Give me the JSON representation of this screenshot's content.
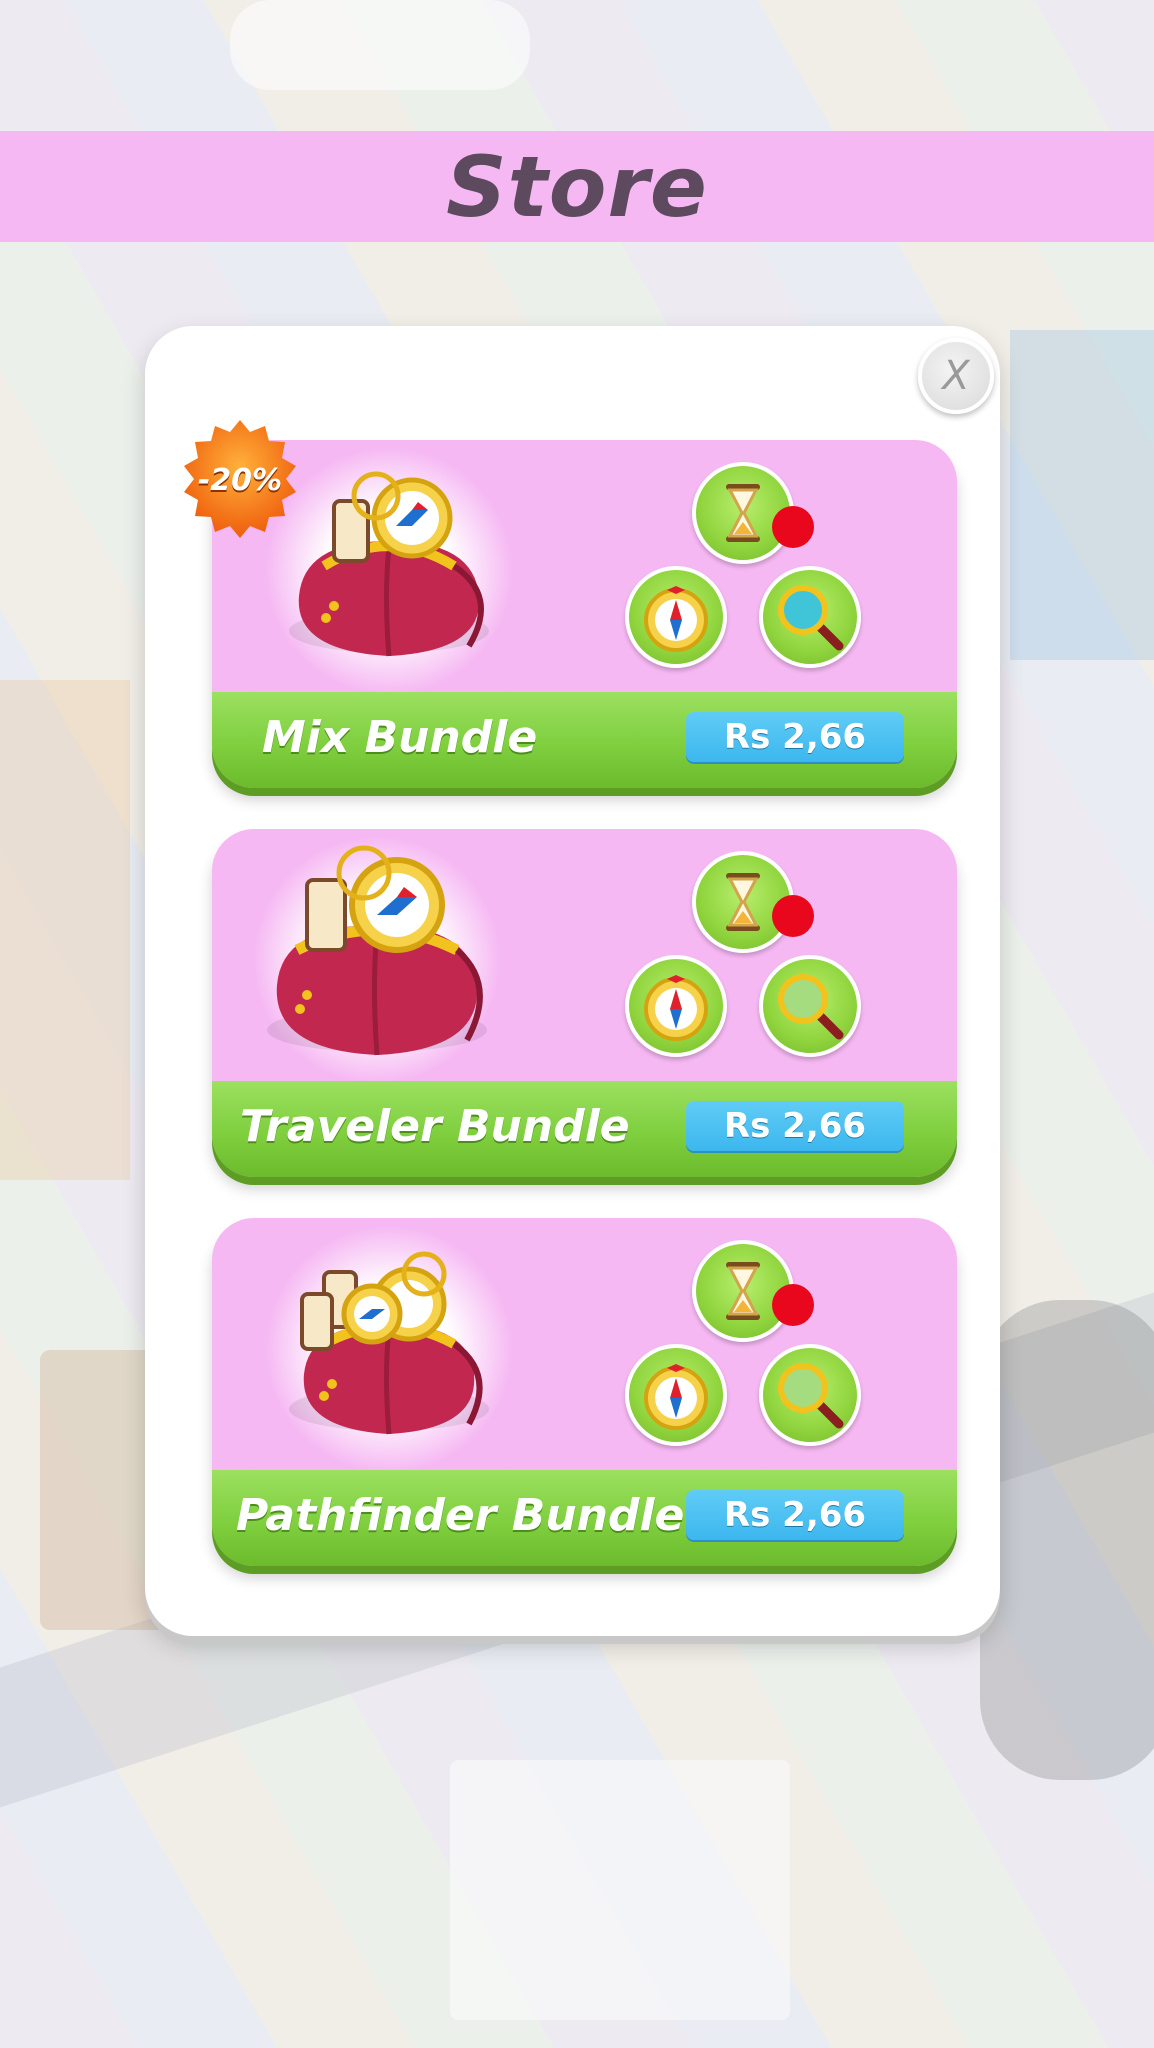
{
  "header": {
    "title": "Store"
  },
  "close_label": "X",
  "bundles": [
    {
      "name": "Mix Bundle",
      "price": "Rs 2,66",
      "discount": "-20%"
    },
    {
      "name": "Traveler Bundle",
      "price": "Rs 2,66"
    },
    {
      "name": "Pathfinder Bundle",
      "price": "Rs 2,66"
    }
  ],
  "icons": {
    "bag": "bundle-bag-icon",
    "hourglass": "hourglass-icon",
    "compass": "compass-icon",
    "magnifier": "magnifier-icon"
  },
  "colors": {
    "title_bar": "#f6b8f3",
    "card_bg": "#f6b8f3",
    "card_footer": "#7fcf3f",
    "price_button": "#3cb7ee",
    "discount_badge": "#f47a15",
    "notification_dot": "#e8071d"
  }
}
